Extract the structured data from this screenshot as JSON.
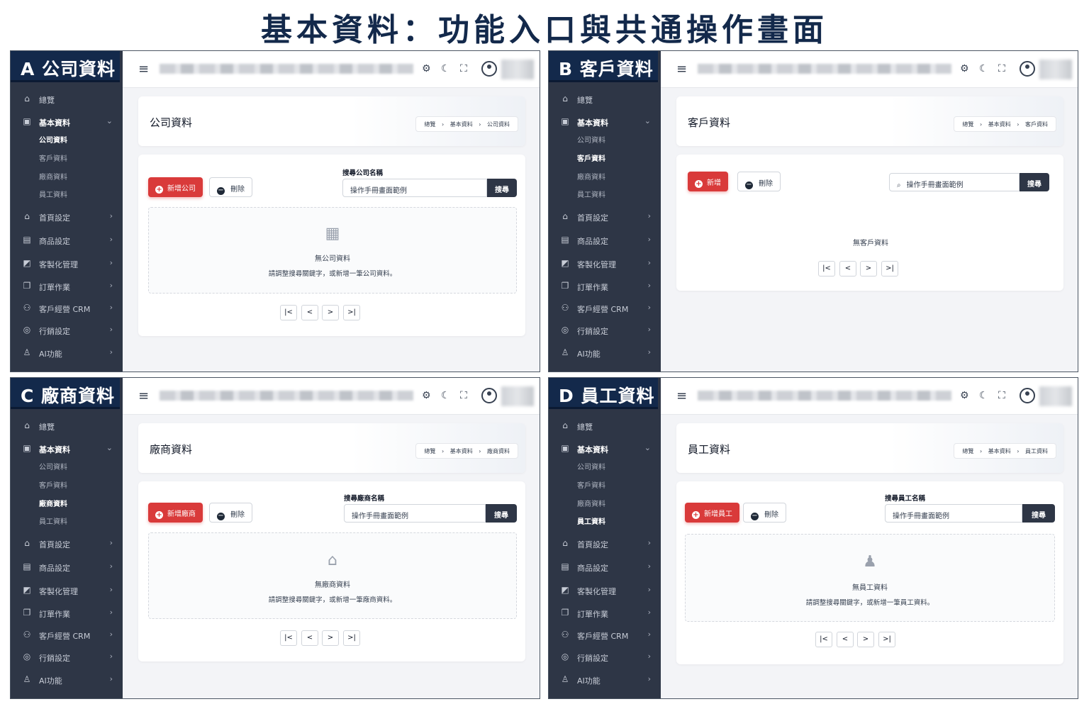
{
  "title": "基本資料：功能入口與共通操作畫面",
  "topbar_icons": [
    "hamburger-icon",
    "gear-icon",
    "moon-icon",
    "fullscreen-icon",
    "user-circle-icon"
  ],
  "nav": {
    "overview": "總覽",
    "basic": "基本資料",
    "sub": [
      "公司資料",
      "客戶資料",
      "廠商資料",
      "員工資料"
    ],
    "groups": [
      "首頁設定",
      "商品設定",
      "客製化管理",
      "訂單作業",
      "客戶經營 CRM",
      "行銷設定",
      "AI功能"
    ]
  },
  "crumb": {
    "home": "總覽",
    "basic": "基本資料",
    "sep": "›"
  },
  "delete_label": "刪除",
  "search_button": "搜尋",
  "search_placeholder": "操作手冊畫面範例",
  "pager": [
    "|<",
    "<",
    ">",
    ">|"
  ],
  "panels": [
    {
      "tag": "A 公司資料",
      "page_title": "公司資料",
      "crumb_current": "公司資料",
      "add_label": "新增公司",
      "search_label": "搜尋公司名稱",
      "empty_title": "無公司資料",
      "empty_hint": "請調整搜尋關鍵字，或新增一筆公司資料。",
      "active_sub": 0,
      "empty_icon": "building-icon"
    },
    {
      "tag": "B 客戶資料",
      "page_title": "客戶資料",
      "crumb_current": "客戶資料",
      "add_label": "新增",
      "search_label": "",
      "empty_title": "無客戶資料",
      "empty_hint": "",
      "active_sub": 1,
      "empty_icon": ""
    },
    {
      "tag": "C 廠商資料",
      "page_title": "廠商資料",
      "crumb_current": "廠商資料",
      "add_label": "新增廠商",
      "search_label": "搜尋廠商名稱",
      "empty_title": "無廠商資料",
      "empty_hint": "請調整搜尋關鍵字，或新增一筆廠商資料。",
      "active_sub": 2,
      "empty_icon": "factory-icon"
    },
    {
      "tag": "D 員工資料",
      "page_title": "員工資料",
      "crumb_current": "員工資料",
      "add_label": "新增員工",
      "search_label": "搜尋員工名稱",
      "empty_title": "無員工資料",
      "empty_hint": "請調整搜尋關鍵字，或新增一筆員工資料。",
      "active_sub": 3,
      "empty_icon": "person-icon"
    }
  ]
}
